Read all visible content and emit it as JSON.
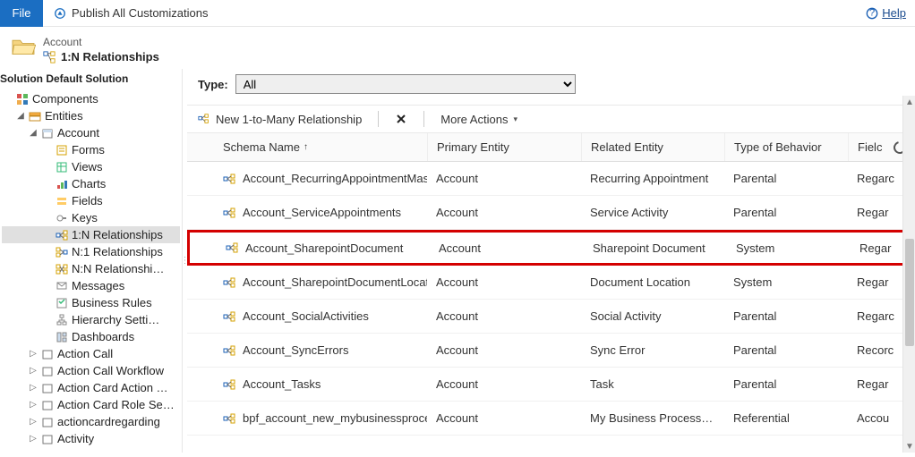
{
  "topbar": {
    "file": "File",
    "publish": "Publish All Customizations",
    "help": "Help"
  },
  "header": {
    "entity": "Account",
    "title": "1:N Relationships"
  },
  "solution_label": "Solution Default Solution",
  "tree": {
    "components": "Components",
    "entities": "Entities",
    "account": "Account",
    "children": {
      "forms": "Forms",
      "views": "Views",
      "charts": "Charts",
      "fields": "Fields",
      "keys": "Keys",
      "rel_1n": "1:N Relationships",
      "rel_n1": "N:1 Relationships",
      "rel_nn": "N:N Relationshi…",
      "messages": "Messages",
      "business_rules": "Business Rules",
      "hierarchy": "Hierarchy Setti…",
      "dashboards": "Dashboards"
    },
    "siblings": {
      "action_call": "Action Call",
      "action_call_wf": "Action Call Workflow",
      "action_card_action": "Action Card Action …",
      "action_card_role": "Action Card Role Se…",
      "action_card_regarding": "actioncardregarding",
      "activity": "Activity"
    }
  },
  "type_row": {
    "label": "Type:",
    "value": "All"
  },
  "toolbar": {
    "new": "New 1-to-Many Relationship",
    "more": "More Actions"
  },
  "columns": {
    "schema": "Schema Name",
    "primary": "Primary Entity",
    "related": "Related Entity",
    "behavior": "Type of Behavior",
    "field": "Fielc"
  },
  "rows": [
    {
      "schema": "Account_RecurringAppointmentMasters",
      "primary": "Account",
      "related": "Recurring Appointment",
      "behavior": "Parental",
      "field": "Regarc"
    },
    {
      "schema": "Account_ServiceAppointments",
      "primary": "Account",
      "related": "Service Activity",
      "behavior": "Parental",
      "field": "Regar"
    },
    {
      "schema": "Account_SharepointDocument",
      "primary": "Account",
      "related": "Sharepoint Document",
      "behavior": "System",
      "field": "Regar",
      "highlight": true
    },
    {
      "schema": "Account_SharepointDocumentLocation",
      "primary": "Account",
      "related": "Document Location",
      "behavior": "System",
      "field": "Regar"
    },
    {
      "schema": "Account_SocialActivities",
      "primary": "Account",
      "related": "Social Activity",
      "behavior": "Parental",
      "field": "Regarc"
    },
    {
      "schema": "Account_SyncErrors",
      "primary": "Account",
      "related": "Sync Error",
      "behavior": "Parental",
      "field": "Recorc"
    },
    {
      "schema": "Account_Tasks",
      "primary": "Account",
      "related": "Task",
      "behavior": "Parental",
      "field": "Regar"
    },
    {
      "schema": "bpf_account_new_mybusinessprocessflow",
      "primary": "Account",
      "related": "My Business Process F…",
      "behavior": "Referential",
      "field": "Accou"
    }
  ]
}
